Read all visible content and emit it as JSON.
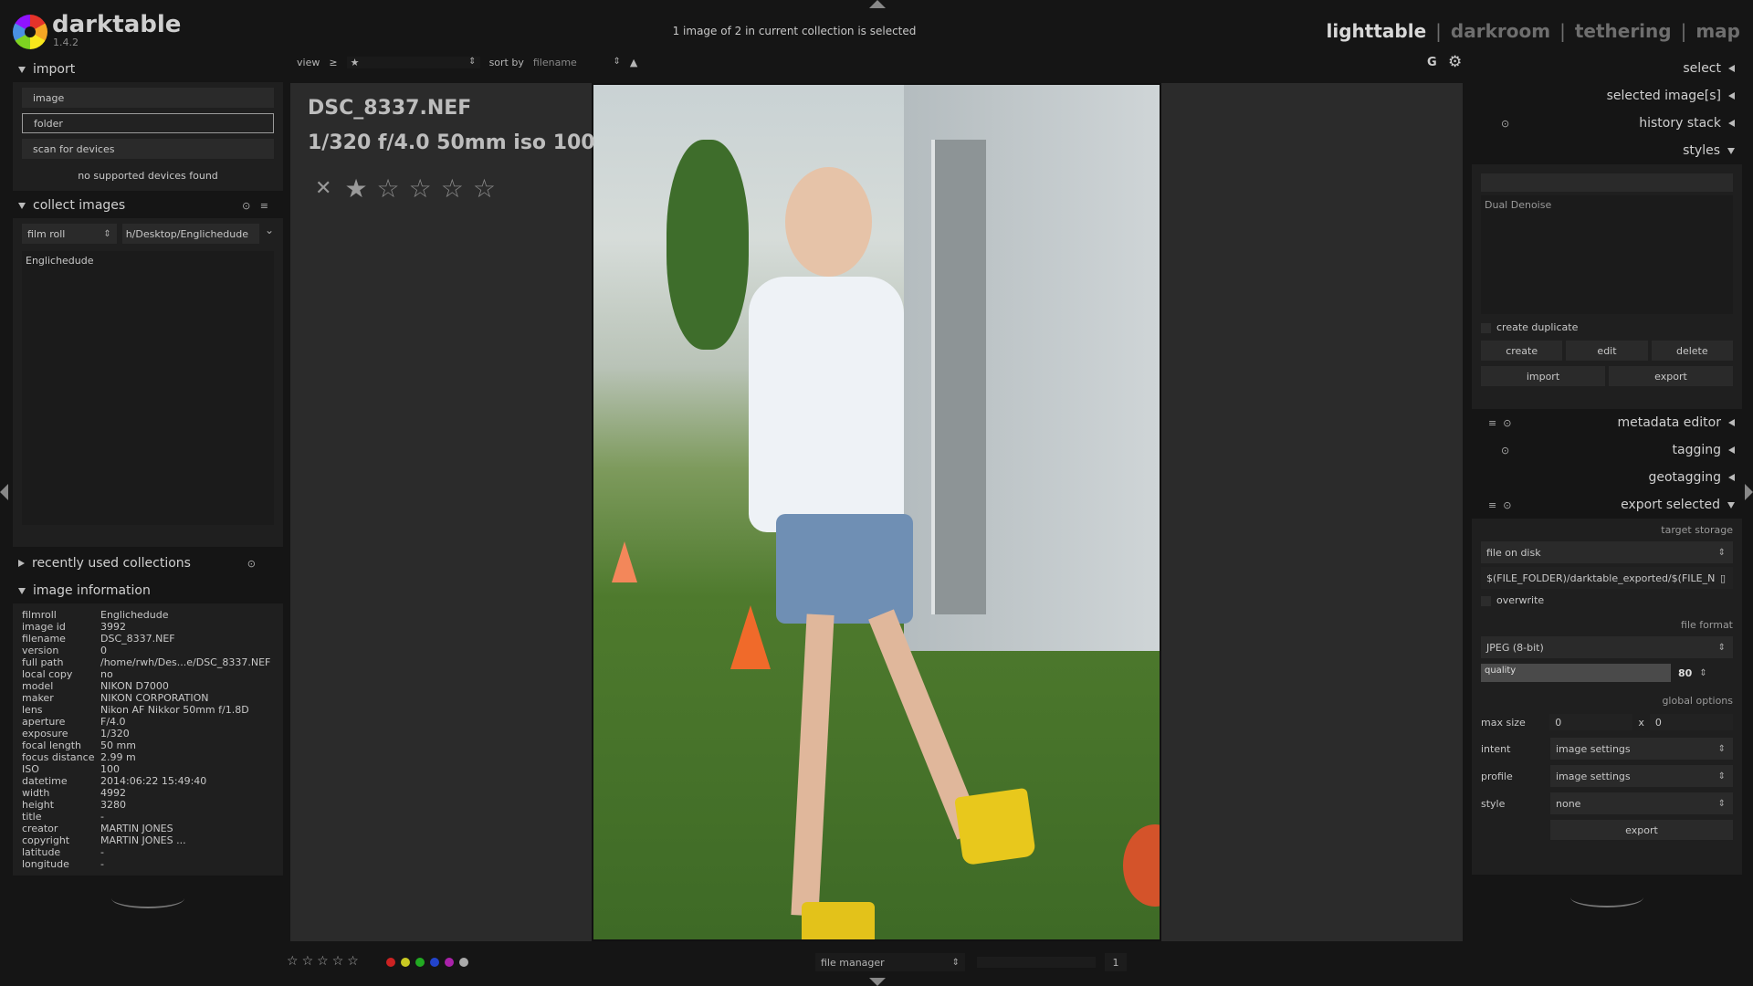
{
  "app": {
    "name": "darktable",
    "version": "1.4.2"
  },
  "header": {
    "selection_status": "1 image of 2 in current collection is selected",
    "views": [
      "lighttable",
      "darkroom",
      "tethering",
      "map"
    ],
    "separator": "|"
  },
  "left_panel": {
    "import": {
      "title": "import",
      "buttons": [
        "image",
        "folder",
        "scan for devices"
      ],
      "devices_status": "no supported devices found"
    },
    "collect": {
      "title": "collect images",
      "criteria_label": "film roll",
      "criteria_value": "h/Desktop/Englichedude",
      "items": [
        "Englichedude"
      ]
    },
    "recent": {
      "title": "recently used collections"
    },
    "image_info": {
      "title": "image information",
      "rows": [
        [
          "filmroll",
          "Englichedude"
        ],
        [
          "image id",
          "3992"
        ],
        [
          "filename",
          "DSC_8337.NEF"
        ],
        [
          "version",
          "0"
        ],
        [
          "full path",
          "/home/rwh/Des...e/DSC_8337.NEF"
        ],
        [
          "local copy",
          "no"
        ],
        [
          "model",
          "NIKON D7000"
        ],
        [
          "maker",
          "NIKON CORPORATION"
        ],
        [
          "lens",
          "Nikon AF Nikkor 50mm f/1.8D"
        ],
        [
          "aperture",
          "F/4.0"
        ],
        [
          "exposure",
          "1/320"
        ],
        [
          "focal length",
          "50 mm"
        ],
        [
          "focus distance",
          "2.99 m"
        ],
        [
          "ISO",
          "100"
        ],
        [
          "datetime",
          "2014:06:22 15:49:40"
        ],
        [
          "width",
          "4992"
        ],
        [
          "height",
          "3280"
        ],
        [
          "title",
          "-"
        ],
        [
          "creator",
          "MARTIN JONES"
        ],
        [
          "copyright",
          "MARTIN JONES    ..."
        ],
        [
          "latitude",
          "-"
        ],
        [
          "longitude",
          "-"
        ]
      ]
    }
  },
  "toolbar": {
    "view_label": "view",
    "view_op": "≥",
    "view_value": "★",
    "sort_label": "sort by",
    "sort_value": "filename",
    "sort_dir": "▲",
    "grouping": "G",
    "settings_icon": "gear-icon"
  },
  "center": {
    "filename": "DSC_8337.NEF",
    "exif": "1/320 f/4.0 50mm iso 100",
    "rating": 1,
    "max_rating": 5,
    "reject_glyph": "✕"
  },
  "right_panel": {
    "modules": {
      "select": "select",
      "selected_images": "selected image[s]",
      "history_stack": "history stack",
      "styles": "styles",
      "metadata_editor": "metadata editor",
      "tagging": "tagging",
      "geotagging": "geotagging",
      "export_selected": "export selected"
    },
    "styles": {
      "search_value": "",
      "list": [
        "Dual Denoise"
      ],
      "create_duplicate": "create duplicate",
      "buttons": [
        "create",
        "edit",
        "delete"
      ],
      "buttons2": [
        "import",
        "export"
      ]
    },
    "export": {
      "target_storage_label": "target storage",
      "storage": "file on disk",
      "path": "$(FILE_FOLDER)/darktable_exported/$(FILE_N",
      "overwrite": "overwrite",
      "file_format_label": "file format",
      "format": "JPEG (8-bit)",
      "quality_label": "quality",
      "quality": "80",
      "global_options_label": "global options",
      "max_size_label": "max size",
      "max_w": "0",
      "max_h": "0",
      "x_sep": "x",
      "intent_label": "intent",
      "intent": "image settings",
      "profile_label": "profile",
      "profile": "image settings",
      "style_label": "style",
      "style": "none",
      "export_button": "export"
    }
  },
  "bottom": {
    "color_labels": [
      "#cc2222",
      "#c8c822",
      "#22aa22",
      "#2244cc",
      "#aa22aa",
      "#aaaaaa"
    ],
    "module_selector": "file manager",
    "zoom_value": "1"
  }
}
